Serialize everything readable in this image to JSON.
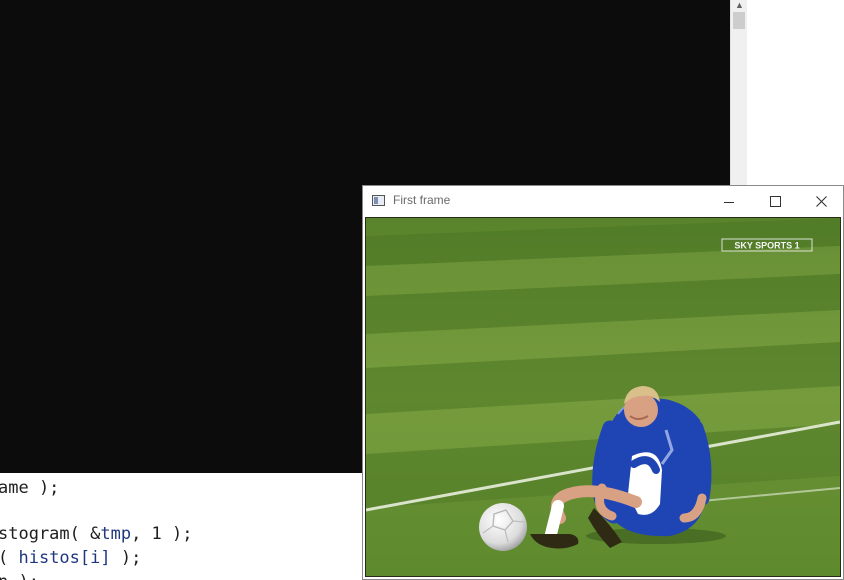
{
  "code_editor": {
    "lines": [
      {
        "before": "ame );",
        "ident": "",
        "after": ""
      },
      {
        "before": "",
        "ident": "",
        "after": ""
      },
      {
        "before": "stogram( &",
        "ident": "tmp",
        "after": ", 1 );"
      },
      {
        "before": "( ",
        "ident": "histos[i]",
        "after": " );"
      },
      {
        "before": "n );",
        "ident": "",
        "after": ""
      }
    ]
  },
  "image_window": {
    "title": "First frame",
    "icon": "app-window-icon",
    "controls": {
      "minimize": "minimize-icon",
      "maximize": "maximize-icon",
      "close": "close-icon"
    },
    "overlay_logo": "SKY SPORTS 1",
    "colors": {
      "pitch": "#5f8a2f",
      "kit": "#1f45b5",
      "console": "#0c0c0c"
    }
  }
}
